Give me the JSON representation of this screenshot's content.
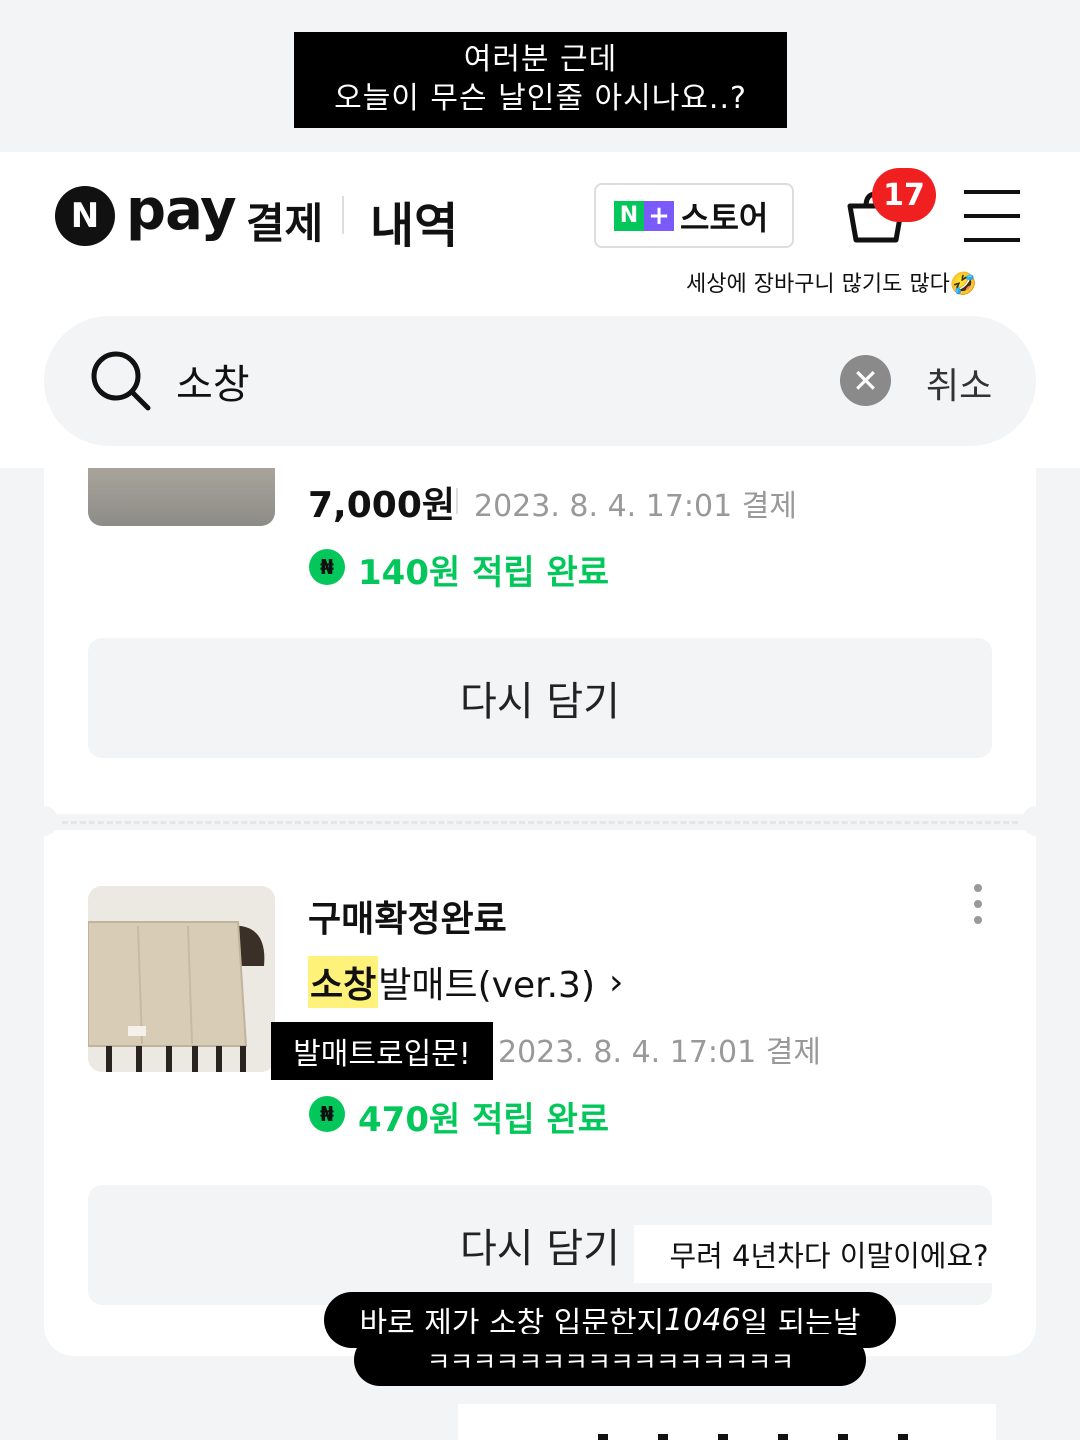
{
  "story": {
    "caption_top_line1": "여러분 근데",
    "caption_top_line2": "오늘이 무슨 날인줄 아시나요..?",
    "cart_caption": "세상에 장바구니 많기도 많다🤣",
    "label_matt": "발매트로입문!",
    "caption_mid": "무려 4년차다 이말이에요?",
    "bubble_pre": "바로 제가 소창 입문한지 ",
    "bubble_num": "1046",
    "bubble_post": "일 되는날",
    "bubble_laugh": "ㅋㅋㅋㅋㅋㅋㅋㅋㅋㅋㅋㅋㅋㅋㅋㅋ"
  },
  "header": {
    "logo_n": "N",
    "logo_pay": "pay",
    "logo_gyeolje": "결제",
    "logo_naeyeok": "내역",
    "store_n": "N",
    "store_plus": "+",
    "store_label": "스토어",
    "cart_count": "17",
    "icons": [
      "cart-icon",
      "menu-icon"
    ]
  },
  "search": {
    "query": "소창",
    "cancel_label": "취소",
    "clear_symbol": "✕",
    "icons": [
      "search-icon",
      "clear-icon"
    ]
  },
  "orders": [
    {
      "price": "7,000원",
      "date": "2023. 8. 4. 17:01 결제",
      "points": "140원 적립 완료",
      "again_label": "다시 담기"
    },
    {
      "status": "구매확정완료",
      "product_highlight": "소창",
      "product_rest": " 발매트(ver.3)",
      "chevron": "›",
      "date": "2023. 8. 4. 17:01 결제",
      "points": "470원 적립 완료",
      "again_label": "다시 담기"
    }
  ],
  "colors": {
    "naver_green": "#03c75a",
    "badge_red": "#f12020",
    "store_purple": "#7a5af8",
    "highlight_yellow": "#fff27a"
  }
}
